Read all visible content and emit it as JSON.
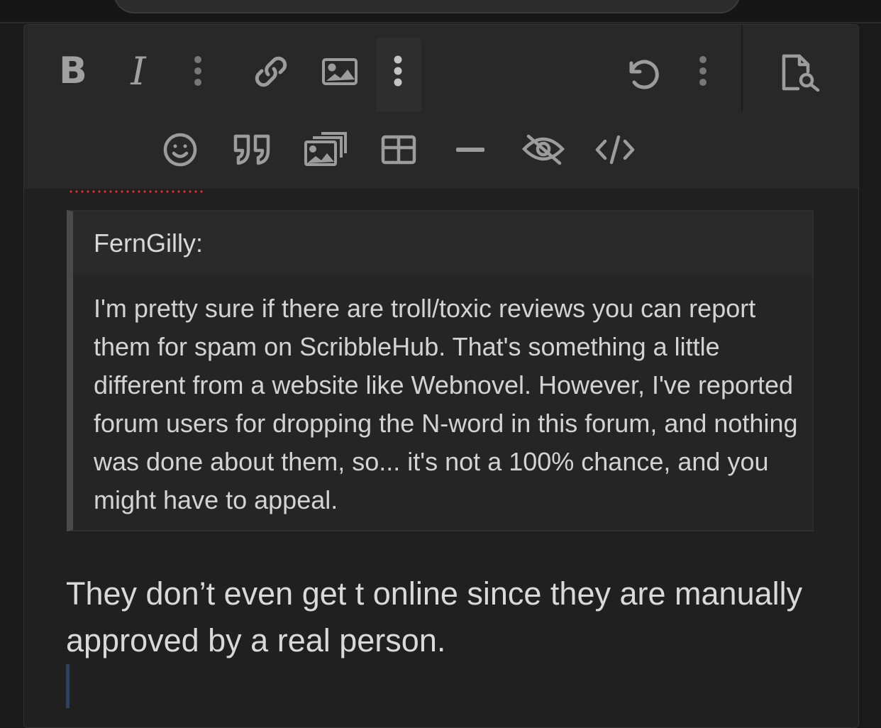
{
  "toolbar": {
    "row1": [
      {
        "name": "bold-button",
        "icon": "bold-icon",
        "label": "B"
      },
      {
        "name": "italic-button",
        "icon": "italic-icon",
        "label": "I"
      },
      {
        "name": "text-more-button",
        "icon": "vertical-dots-icon"
      },
      {
        "name": "link-button",
        "icon": "link-icon"
      },
      {
        "name": "image-button",
        "icon": "image-icon"
      },
      {
        "name": "insert-more-button",
        "icon": "vertical-dots-icon",
        "active": true
      },
      {
        "name": "undo-button",
        "icon": "undo-icon"
      },
      {
        "name": "history-more-button",
        "icon": "vertical-dots-icon"
      },
      {
        "name": "preview-button",
        "icon": "preview-document-icon"
      }
    ],
    "row2": [
      {
        "name": "emoji-button",
        "icon": "smiley-icon"
      },
      {
        "name": "quote-button",
        "icon": "quote-icon"
      },
      {
        "name": "gallery-button",
        "icon": "gallery-icon"
      },
      {
        "name": "table-button",
        "icon": "table-icon"
      },
      {
        "name": "horizontal-rule-button",
        "icon": "minus-icon"
      },
      {
        "name": "spoiler-button",
        "icon": "eye-slash-icon"
      },
      {
        "name": "code-button",
        "icon": "code-icon"
      }
    ]
  },
  "quote": {
    "author": "FernGilly:",
    "body": "I'm pretty sure if there are troll/toxic reviews you can report them for spam on ScribbleHub. That's something a little different from a website like Webnovel. However, I've reported forum users for dropping the N-word in this forum, and nothing was done about them, so... it's not a 100% chance, and you might have to appeal."
  },
  "reply": {
    "text": "They don’t even get t online since they are manually approved by a real person."
  },
  "colors": {
    "background": "#1a1a1a",
    "editor": "#202020",
    "toolbar": "#282828",
    "icon": "#9c9c9c",
    "spellcheck": "#e0302a",
    "caret": "#2b4266"
  }
}
